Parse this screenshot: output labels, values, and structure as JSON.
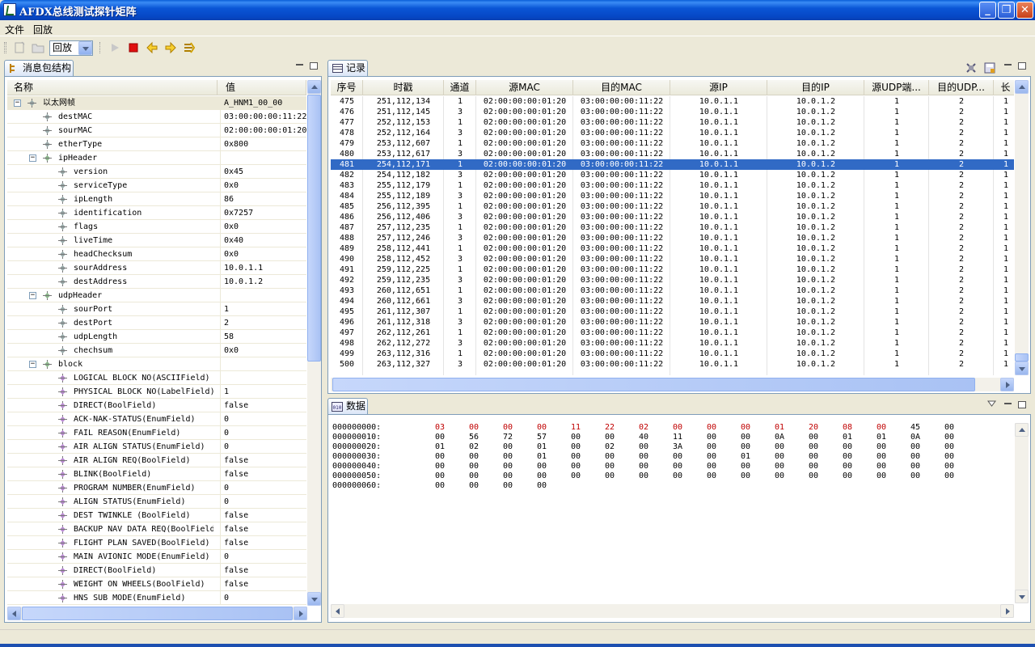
{
  "window": {
    "title": "AFDX总线测试探针矩阵"
  },
  "menu": [
    "文件",
    "回放"
  ],
  "toolbar": {
    "combo_value": "回放"
  },
  "structure_view": {
    "tab_label": "消息包结构",
    "col_name": "名称",
    "col_value": "值",
    "rows": [
      {
        "name": "以太网帧",
        "value": "A_HNM1_00_00",
        "level": 0,
        "expand": "−",
        "icon": "diamond"
      },
      {
        "name": "destMAC",
        "value": "03:00:00:00:11:22",
        "level": 1,
        "expand": "",
        "icon": "diamond"
      },
      {
        "name": "sourMAC",
        "value": "02:00:00:00:01:20",
        "level": 1,
        "expand": "",
        "icon": "diamond"
      },
      {
        "name": "etherType",
        "value": "0x800",
        "level": 1,
        "expand": "",
        "icon": "diamond"
      },
      {
        "name": "ipHeader",
        "value": "",
        "level": 1,
        "expand": "−",
        "icon": "green"
      },
      {
        "name": "version",
        "value": "0x45",
        "level": 2,
        "expand": "",
        "icon": "diamond"
      },
      {
        "name": "serviceType",
        "value": "0x0",
        "level": 2,
        "expand": "",
        "icon": "diamond"
      },
      {
        "name": "ipLength",
        "value": "86",
        "level": 2,
        "expand": "",
        "icon": "diamond"
      },
      {
        "name": "identification",
        "value": "0x7257",
        "level": 2,
        "expand": "",
        "icon": "diamond"
      },
      {
        "name": "flags",
        "value": "0x0",
        "level": 2,
        "expand": "",
        "icon": "diamond"
      },
      {
        "name": "liveTime",
        "value": "0x40",
        "level": 2,
        "expand": "",
        "icon": "diamond"
      },
      {
        "name": "headChecksum",
        "value": "0x0",
        "level": 2,
        "expand": "",
        "icon": "diamond"
      },
      {
        "name": "sourAddress",
        "value": "10.0.1.1",
        "level": 2,
        "expand": "",
        "icon": "diamond"
      },
      {
        "name": "destAddress",
        "value": "10.0.1.2",
        "level": 2,
        "expand": "",
        "icon": "diamond"
      },
      {
        "name": "udpHeader",
        "value": "",
        "level": 1,
        "expand": "−",
        "icon": "green"
      },
      {
        "name": "sourPort",
        "value": "1",
        "level": 2,
        "expand": "",
        "icon": "diamond"
      },
      {
        "name": "destPort",
        "value": "2",
        "level": 2,
        "expand": "",
        "icon": "diamond"
      },
      {
        "name": "udpLength",
        "value": "58",
        "level": 2,
        "expand": "",
        "icon": "diamond"
      },
      {
        "name": "chechsum",
        "value": "0x0",
        "level": 2,
        "expand": "",
        "icon": "diamond"
      },
      {
        "name": "block",
        "value": "",
        "level": 1,
        "expand": "−",
        "icon": "green"
      },
      {
        "name": "LOGICAL BLOCK NO(ASCIIField)",
        "value": "",
        "level": 2,
        "expand": "",
        "icon": "purple"
      },
      {
        "name": "PHYSICAL BLOCK NO(LabelField)",
        "value": "1",
        "level": 2,
        "expand": "",
        "icon": "purple"
      },
      {
        "name": "DIRECT(BoolField)",
        "value": "false",
        "level": 2,
        "expand": "",
        "icon": "purple"
      },
      {
        "name": "ACK-NAK-STATUS(EnumField)",
        "value": "0",
        "level": 2,
        "expand": "",
        "icon": "purple"
      },
      {
        "name": "FAIL REASON(EnumField)",
        "value": "0",
        "level": 2,
        "expand": "",
        "icon": "purple"
      },
      {
        "name": "AIR ALIGN STATUS(EnumField)",
        "value": "0",
        "level": 2,
        "expand": "",
        "icon": "purple"
      },
      {
        "name": "AIR ALIGN REQ(BoolField)",
        "value": "false",
        "level": 2,
        "expand": "",
        "icon": "purple"
      },
      {
        "name": "BLINK(BoolField)",
        "value": "false",
        "level": 2,
        "expand": "",
        "icon": "purple"
      },
      {
        "name": "PROGRAM NUMBER(EnumField)",
        "value": "0",
        "level": 2,
        "expand": "",
        "icon": "purple"
      },
      {
        "name": "ALIGN STATUS(EnumField)",
        "value": "0",
        "level": 2,
        "expand": "",
        "icon": "purple"
      },
      {
        "name": "DEST TWINKLE (BoolField)",
        "value": "false",
        "level": 2,
        "expand": "",
        "icon": "purple"
      },
      {
        "name": "BACKUP NAV DATA REQ(BoolField)",
        "value": "false",
        "level": 2,
        "expand": "",
        "icon": "purple"
      },
      {
        "name": "FLIGHT PLAN SAVED(BoolField)",
        "value": "false",
        "level": 2,
        "expand": "",
        "icon": "purple"
      },
      {
        "name": "MAIN AVIONIC MODE(EnumField)",
        "value": "0",
        "level": 2,
        "expand": "",
        "icon": "purple"
      },
      {
        "name": "DIRECT(BoolField)",
        "value": "false",
        "level": 2,
        "expand": "",
        "icon": "purple"
      },
      {
        "name": "WEIGHT ON WHEELS(BoolField)",
        "value": "false",
        "level": 2,
        "expand": "",
        "icon": "purple"
      },
      {
        "name": "HNS SUB MODE(EnumField)",
        "value": "0",
        "level": 2,
        "expand": "",
        "icon": "purple"
      }
    ]
  },
  "records_view": {
    "tab_label": "记录",
    "columns": [
      "序号",
      "时戳",
      "通道",
      "源MAC",
      "目的MAC",
      "源IP",
      "目的IP",
      "源UDP端...",
      "目的UDP...",
      "长"
    ],
    "selected_seq": "481",
    "rows": [
      [
        "475",
        "251,112,134",
        "1",
        "02:00:00:00:01:20",
        "03:00:00:00:11:22",
        "10.0.1.1",
        "10.0.1.2",
        "1",
        "2",
        "1"
      ],
      [
        "476",
        "251,112,145",
        "3",
        "02:00:00:00:01:20",
        "03:00:00:00:11:22",
        "10.0.1.1",
        "10.0.1.2",
        "1",
        "2",
        "1"
      ],
      [
        "477",
        "252,112,153",
        "1",
        "02:00:00:00:01:20",
        "03:00:00:00:11:22",
        "10.0.1.1",
        "10.0.1.2",
        "1",
        "2",
        "1"
      ],
      [
        "478",
        "252,112,164",
        "3",
        "02:00:00:00:01:20",
        "03:00:00:00:11:22",
        "10.0.1.1",
        "10.0.1.2",
        "1",
        "2",
        "1"
      ],
      [
        "479",
        "253,112,607",
        "1",
        "02:00:00:00:01:20",
        "03:00:00:00:11:22",
        "10.0.1.1",
        "10.0.1.2",
        "1",
        "2",
        "1"
      ],
      [
        "480",
        "253,112,617",
        "3",
        "02:00:00:00:01:20",
        "03:00:00:00:11:22",
        "10.0.1.1",
        "10.0.1.2",
        "1",
        "2",
        "1"
      ],
      [
        "481",
        "254,112,171",
        "1",
        "02:00:00:00:01:20",
        "03:00:00:00:11:22",
        "10.0.1.1",
        "10.0.1.2",
        "1",
        "2",
        "1"
      ],
      [
        "482",
        "254,112,182",
        "3",
        "02:00:00:00:01:20",
        "03:00:00:00:11:22",
        "10.0.1.1",
        "10.0.1.2",
        "1",
        "2",
        "1"
      ],
      [
        "483",
        "255,112,179",
        "1",
        "02:00:00:00:01:20",
        "03:00:00:00:11:22",
        "10.0.1.1",
        "10.0.1.2",
        "1",
        "2",
        "1"
      ],
      [
        "484",
        "255,112,189",
        "3",
        "02:00:00:00:01:20",
        "03:00:00:00:11:22",
        "10.0.1.1",
        "10.0.1.2",
        "1",
        "2",
        "1"
      ],
      [
        "485",
        "256,112,395",
        "1",
        "02:00:00:00:01:20",
        "03:00:00:00:11:22",
        "10.0.1.1",
        "10.0.1.2",
        "1",
        "2",
        "1"
      ],
      [
        "486",
        "256,112,406",
        "3",
        "02:00:00:00:01:20",
        "03:00:00:00:11:22",
        "10.0.1.1",
        "10.0.1.2",
        "1",
        "2",
        "1"
      ],
      [
        "487",
        "257,112,235",
        "1",
        "02:00:00:00:01:20",
        "03:00:00:00:11:22",
        "10.0.1.1",
        "10.0.1.2",
        "1",
        "2",
        "1"
      ],
      [
        "488",
        "257,112,246",
        "3",
        "02:00:00:00:01:20",
        "03:00:00:00:11:22",
        "10.0.1.1",
        "10.0.1.2",
        "1",
        "2",
        "1"
      ],
      [
        "489",
        "258,112,441",
        "1",
        "02:00:00:00:01:20",
        "03:00:00:00:11:22",
        "10.0.1.1",
        "10.0.1.2",
        "1",
        "2",
        "1"
      ],
      [
        "490",
        "258,112,452",
        "3",
        "02:00:00:00:01:20",
        "03:00:00:00:11:22",
        "10.0.1.1",
        "10.0.1.2",
        "1",
        "2",
        "1"
      ],
      [
        "491",
        "259,112,225",
        "1",
        "02:00:00:00:01:20",
        "03:00:00:00:11:22",
        "10.0.1.1",
        "10.0.1.2",
        "1",
        "2",
        "1"
      ],
      [
        "492",
        "259,112,235",
        "3",
        "02:00:00:00:01:20",
        "03:00:00:00:11:22",
        "10.0.1.1",
        "10.0.1.2",
        "1",
        "2",
        "1"
      ],
      [
        "493",
        "260,112,651",
        "1",
        "02:00:00:00:01:20",
        "03:00:00:00:11:22",
        "10.0.1.1",
        "10.0.1.2",
        "1",
        "2",
        "1"
      ],
      [
        "494",
        "260,112,661",
        "3",
        "02:00:00:00:01:20",
        "03:00:00:00:11:22",
        "10.0.1.1",
        "10.0.1.2",
        "1",
        "2",
        "1"
      ],
      [
        "495",
        "261,112,307",
        "1",
        "02:00:00:00:01:20",
        "03:00:00:00:11:22",
        "10.0.1.1",
        "10.0.1.2",
        "1",
        "2",
        "1"
      ],
      [
        "496",
        "261,112,318",
        "3",
        "02:00:00:00:01:20",
        "03:00:00:00:11:22",
        "10.0.1.1",
        "10.0.1.2",
        "1",
        "2",
        "1"
      ],
      [
        "497",
        "262,112,261",
        "1",
        "02:00:00:00:01:20",
        "03:00:00:00:11:22",
        "10.0.1.1",
        "10.0.1.2",
        "1",
        "2",
        "1"
      ],
      [
        "498",
        "262,112,272",
        "3",
        "02:00:00:00:01:20",
        "03:00:00:00:11:22",
        "10.0.1.1",
        "10.0.1.2",
        "1",
        "2",
        "1"
      ],
      [
        "499",
        "263,112,316",
        "1",
        "02:00:00:00:01:20",
        "03:00:00:00:11:22",
        "10.0.1.1",
        "10.0.1.2",
        "1",
        "2",
        "1"
      ],
      [
        "500",
        "263,112,327",
        "3",
        "02:00:00:00:01:20",
        "03:00:00:00:11:22",
        "10.0.1.1",
        "10.0.1.2",
        "1",
        "2",
        "1"
      ]
    ]
  },
  "data_view": {
    "tab_label": "数据",
    "highlight_color": "#c00000",
    "lines": [
      {
        "addr": "000000000:",
        "bytes": [
          "03",
          "00",
          "00",
          "00",
          "11",
          "22",
          "02",
          "00",
          "00",
          "00",
          "01",
          "20",
          "08",
          "00",
          "45",
          "00"
        ],
        "red_count": 14
      },
      {
        "addr": "000000010:",
        "bytes": [
          "00",
          "56",
          "72",
          "57",
          "00",
          "00",
          "40",
          "11",
          "00",
          "00",
          "0A",
          "00",
          "01",
          "01",
          "0A",
          "00"
        ],
        "red_count": 0
      },
      {
        "addr": "000000020:",
        "bytes": [
          "01",
          "02",
          "00",
          "01",
          "00",
          "02",
          "00",
          "3A",
          "00",
          "00",
          "00",
          "00",
          "00",
          "00",
          "00",
          "00"
        ],
        "red_count": 0
      },
      {
        "addr": "000000030:",
        "bytes": [
          "00",
          "00",
          "00",
          "01",
          "00",
          "00",
          "00",
          "00",
          "00",
          "01",
          "00",
          "00",
          "00",
          "00",
          "00",
          "00"
        ],
        "red_count": 0
      },
      {
        "addr": "000000040:",
        "bytes": [
          "00",
          "00",
          "00",
          "00",
          "00",
          "00",
          "00",
          "00",
          "00",
          "00",
          "00",
          "00",
          "00",
          "00",
          "00",
          "00"
        ],
        "red_count": 0
      },
      {
        "addr": "000000050:",
        "bytes": [
          "00",
          "00",
          "00",
          "00",
          "00",
          "00",
          "00",
          "00",
          "00",
          "00",
          "00",
          "00",
          "00",
          "00",
          "00",
          "00"
        ],
        "red_count": 0
      },
      {
        "addr": "000000060:",
        "bytes": [
          "00",
          "00",
          "00",
          "00"
        ],
        "red_count": 0
      }
    ]
  }
}
